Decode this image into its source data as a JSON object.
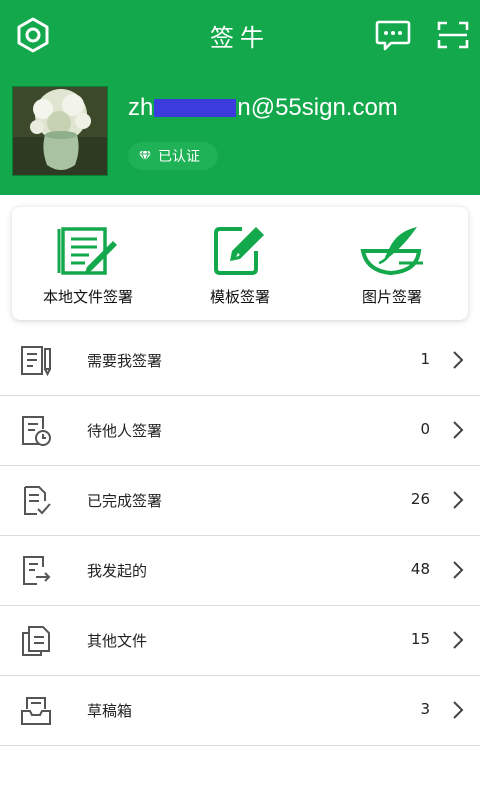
{
  "header": {
    "title": "签牛",
    "email_prefix": "zh",
    "email_suffix": "n@55sign.com",
    "verified_label": "已认证",
    "settings_icon": "settings-icon",
    "message_icon": "message-icon",
    "scan_icon": "scan-icon"
  },
  "actions": [
    {
      "label": "本地文件签署",
      "icon": "local-file-sign-icon"
    },
    {
      "label": "模板签署",
      "icon": "template-sign-icon"
    },
    {
      "label": "图片签署",
      "icon": "image-sign-icon"
    }
  ],
  "list": [
    {
      "label": "需要我签署",
      "count": "1",
      "icon": "document-pen-icon"
    },
    {
      "label": "待他人签署",
      "count": "0",
      "icon": "document-clock-icon"
    },
    {
      "label": "已完成签署",
      "count": "26",
      "icon": "document-check-icon"
    },
    {
      "label": "我发起的",
      "count": "48",
      "icon": "document-send-icon"
    },
    {
      "label": "其他文件",
      "count": "15",
      "icon": "documents-icon"
    },
    {
      "label": "草稿箱",
      "count": "3",
      "icon": "inbox-tray-icon"
    }
  ],
  "colors": {
    "brand_green": "#13a84b",
    "mask_blue": "#3b3bde",
    "icon_gray": "#555555"
  }
}
